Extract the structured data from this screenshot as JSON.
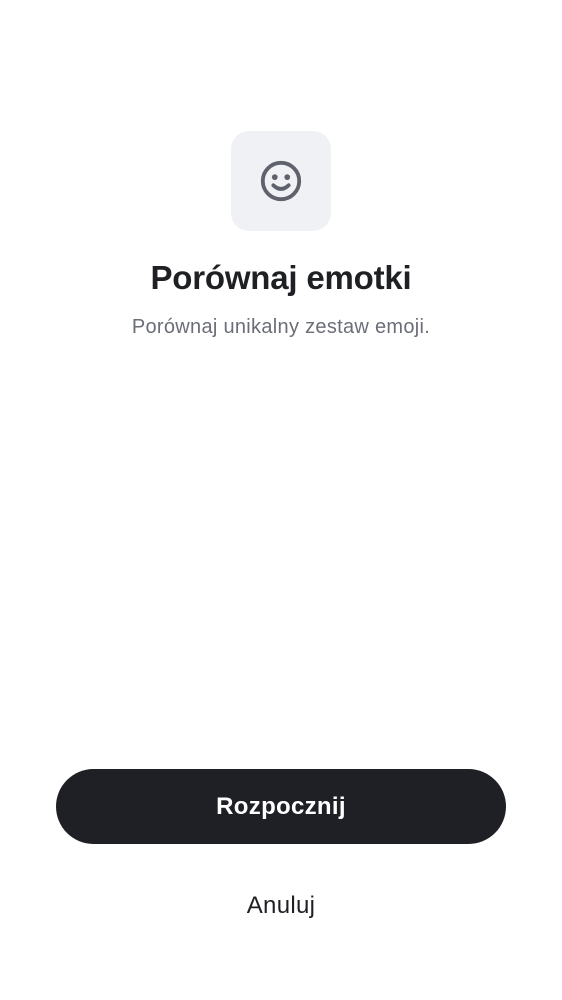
{
  "header": {
    "icon": "smiley-face-icon",
    "title": "Porównaj emotki",
    "subtitle": "Porównaj unikalny zestaw emoji."
  },
  "actions": {
    "primary_label": "Rozpocznij",
    "secondary_label": "Anuluj"
  },
  "colors": {
    "icon_tile_background": "#f0f1f4",
    "icon_stroke": "#5f626c",
    "title_text": "#1f2024",
    "subtitle_text": "#6b6e78",
    "primary_button_background": "#1f2026",
    "primary_button_text": "#ffffff"
  }
}
